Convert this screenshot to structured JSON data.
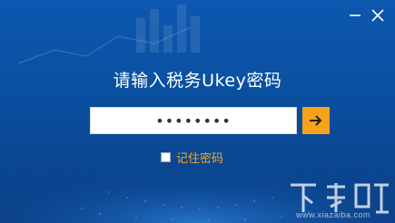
{
  "dialog": {
    "title": "请输入税务Ukey密码",
    "password_value": "••••••••",
    "remember_label": "记住密码",
    "remember_checked": false,
    "submit_icon": "arrow-right-icon"
  },
  "window_controls": {
    "minimize_icon": "minimize-icon",
    "close_icon": "close-icon"
  },
  "watermark": {
    "logo_glyph": "下载吧",
    "url": "www.xiazaiba.com"
  },
  "colors": {
    "background": "#0a4f9f",
    "accent": "#f7a21b",
    "label": "#f5a623"
  }
}
